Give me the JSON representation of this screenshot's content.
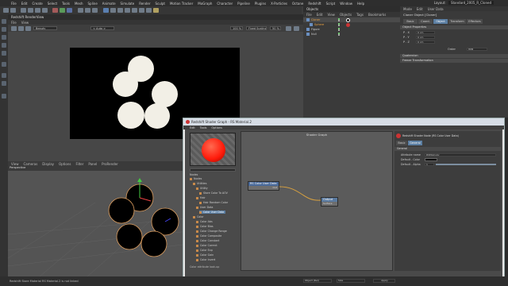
{
  "menubar": {
    "items": [
      "File",
      "Edit",
      "Create",
      "Select",
      "Tools",
      "Mesh",
      "Spline",
      "Animate",
      "Simulate",
      "Render",
      "Sculpt",
      "Motion Tracker",
      "MoGraph",
      "Character",
      "Pipeline",
      "Plugins",
      "X-Particles",
      "Octane",
      "Redshift",
      "Script",
      "Window",
      "Help"
    ],
    "layout_label": "Layout:",
    "layout_value": "Standard_2005_R_Cloned"
  },
  "render_view": {
    "title": "Redshift RenderView",
    "menu": [
      "File",
      "View"
    ],
    "mode_dropdown": "Beauty",
    "aov_dropdown": "< Auto >",
    "zoom": "100 %",
    "scaling_dropdown": "Fixed Scaling",
    "scaling_pct": "50 %",
    "frame_info": "Frame: 0 · 2018-10-23 08:40:51 (2.72s)"
  },
  "viewport": {
    "menu": [
      "View",
      "Cameras",
      "Display",
      "Options",
      "Filter",
      "Panel",
      "ProRender"
    ],
    "label": "Perspective"
  },
  "object_manager": {
    "title": "Objects",
    "menu": [
      "File",
      "Edit",
      "View",
      "Objects",
      "Tags",
      "Bookmarks"
    ],
    "items": [
      {
        "name": "Cloner"
      },
      {
        "name": "Sphere"
      },
      {
        "name": "Figure"
      },
      {
        "name": "Null"
      }
    ]
  },
  "attribute_manager": {
    "menu": [
      "Mode",
      "Edit",
      "User Data"
    ],
    "header": "Cloner Object [Cloner]",
    "tabs": [
      "Basic",
      "Coord.",
      "Object",
      "Transform",
      "Effectors"
    ],
    "section_object": "Object Properties",
    "rows": [
      {
        "label": "P . X",
        "value": "0 cm"
      },
      {
        "label": "P . Y",
        "value": "0 cm"
      },
      {
        "label": "P . Z",
        "value": "0 cm"
      }
    ],
    "order_label": "Order",
    "order_value": "HPB",
    "section_quaternion": "Quaternion",
    "section_freeze": "Freeze Transformation"
  },
  "shader_graph": {
    "title": "Redshift Shader Graph - RS Material.2",
    "menu": [
      "Edit",
      "Tools",
      "Options"
    ],
    "canvas_title": "Shader Graph",
    "search_label": "Nodes",
    "tree": [
      {
        "indent": 0,
        "label": "Nodes"
      },
      {
        "indent": 1,
        "label": "Utilities"
      },
      {
        "indent": 2,
        "label": "Utility"
      },
      {
        "indent": 3,
        "label": "Store Color To AOV"
      },
      {
        "indent": 2,
        "label": "Hair"
      },
      {
        "indent": 3,
        "label": "Hair Random Color"
      },
      {
        "indent": 2,
        "label": "User Data"
      },
      {
        "indent": 3,
        "label": "Color User Data"
      },
      {
        "indent": 1,
        "label": "Color"
      },
      {
        "indent": 2,
        "label": "Color Abs"
      },
      {
        "indent": 2,
        "label": "Color Bias"
      },
      {
        "indent": 2,
        "label": "Color Change Range"
      },
      {
        "indent": 2,
        "label": "Color Composite"
      },
      {
        "indent": 2,
        "label": "Color Constant"
      },
      {
        "indent": 2,
        "label": "Color Correct"
      },
      {
        "indent": 2,
        "label": "Color Exp"
      },
      {
        "indent": 2,
        "label": "Color Gain"
      },
      {
        "indent": 2,
        "label": "Color Invert"
      }
    ],
    "footer_hint": "Color attribute look-up",
    "node_user_data": {
      "title": "RS Color User Data",
      "port": "Out"
    },
    "node_output": {
      "title": "Output",
      "port": "Surface"
    },
    "preview_color": "#ff1a0a",
    "props": {
      "header": "Redshift Shader Node (RS Color User Data)",
      "tabs": [
        "Basic",
        "General"
      ],
      "section": "General",
      "attribute_label": "Attribute name",
      "attribute_value": "RSMGColor",
      "default_color_label": "Default - Color",
      "default_alpha_label": "Default - Alpha",
      "default_alpha_value": "1"
    }
  },
  "status": {
    "text": "Redshift Store Material RS Material.2 is not linked",
    "fields": [
      "Object (Rel)",
      "Size",
      "Apply"
    ]
  },
  "colors": {
    "accent": "#5c7fa3",
    "node_header": "#4a6a9a",
    "output_header": "#5a7aa0",
    "wire": "#d6a040"
  }
}
